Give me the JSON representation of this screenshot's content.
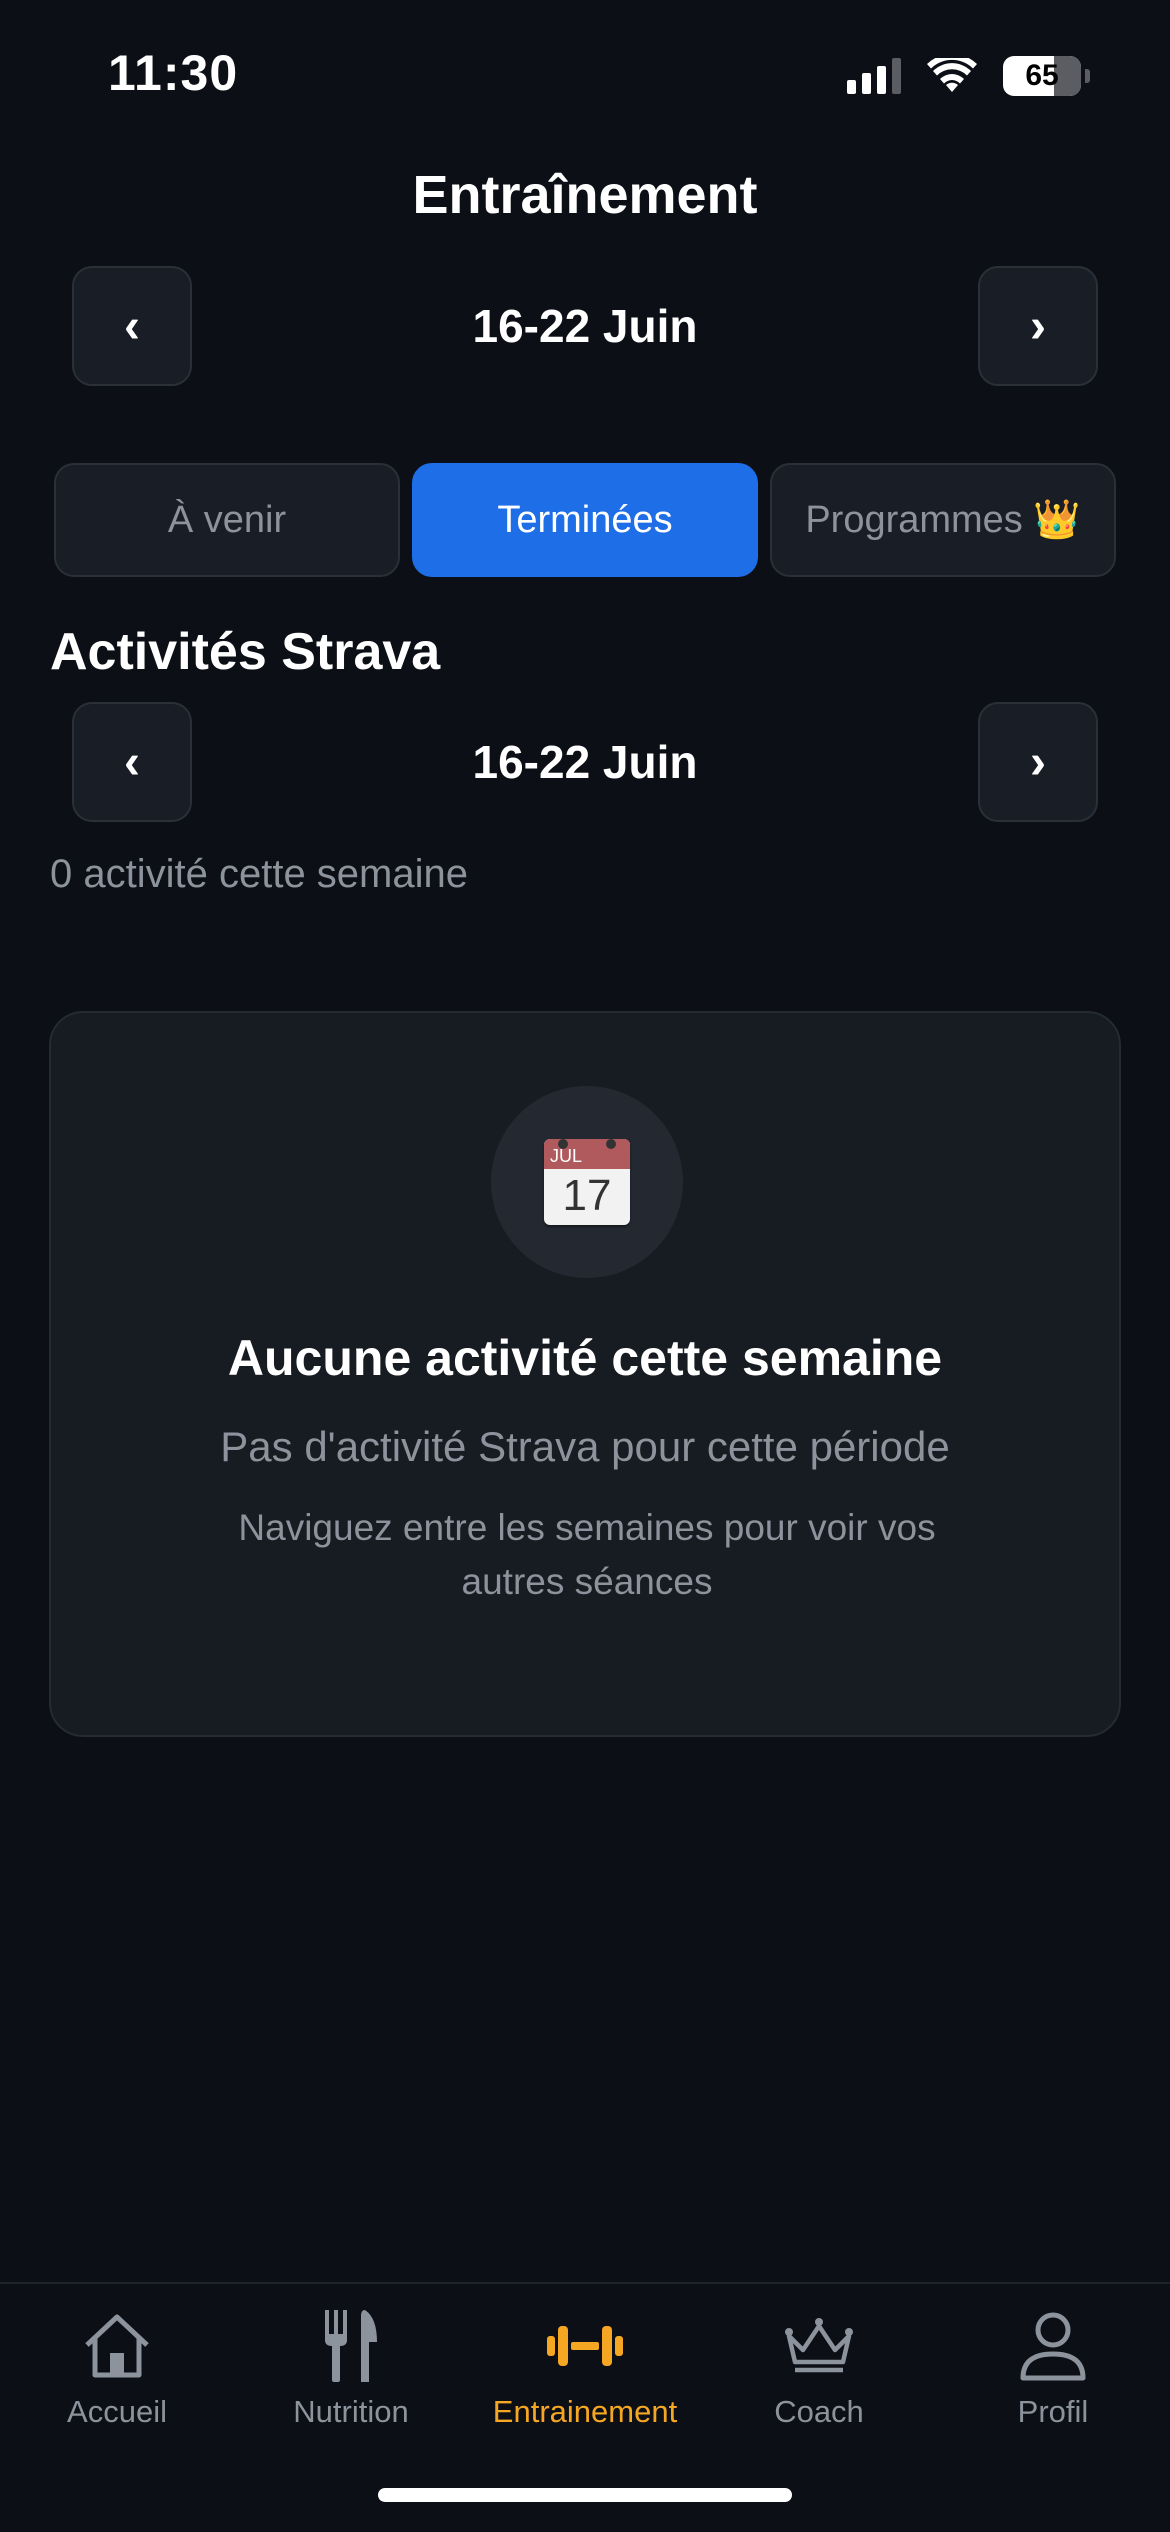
{
  "status_bar": {
    "time": "11:30",
    "battery": "65"
  },
  "header": {
    "title": "Entraînement",
    "week_label": "16-22 Juin",
    "prev": "‹",
    "next": "›"
  },
  "tabs": [
    {
      "label": "À venir",
      "active": false
    },
    {
      "label": "Terminées",
      "active": true
    },
    {
      "label": "Programmes 👑",
      "active": false
    }
  ],
  "strava": {
    "title": "Activités Strava",
    "week_label": "16-22 Juin",
    "prev": "‹",
    "next": "›",
    "count_text": "0 activité cette semaine"
  },
  "empty_state": {
    "icon": "calendar-icon",
    "calendar_month": "JUL",
    "calendar_day": "17",
    "title": "Aucune activité cette semaine",
    "subtitle": "Pas d'activité Strava pour cette période",
    "hint": "Naviguez entre les semaines pour voir vos autres séances"
  },
  "tabbar": {
    "items": [
      {
        "label": "Accueil",
        "icon": "home-icon",
        "active": false
      },
      {
        "label": "Nutrition",
        "icon": "fork-knife-icon",
        "active": false
      },
      {
        "label": "Entrainement",
        "icon": "dumbbell-icon",
        "active": true
      },
      {
        "label": "Coach",
        "icon": "crown-icon",
        "active": false
      },
      {
        "label": "Profil",
        "icon": "person-icon",
        "active": false
      }
    ]
  },
  "colors": {
    "background": "#0c0f16",
    "accent_blue": "#1e6ee8",
    "accent_orange": "#f5a623",
    "muted_text": "#8d939c"
  }
}
